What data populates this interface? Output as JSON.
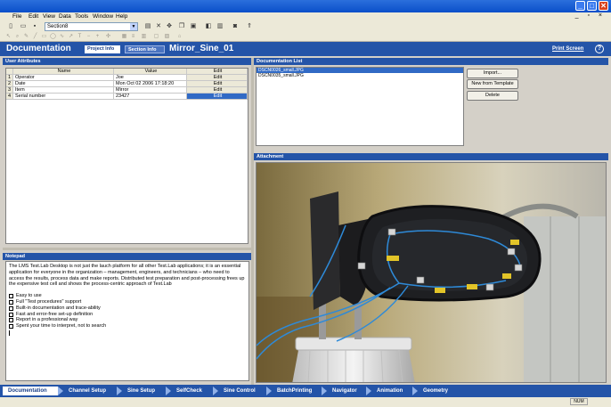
{
  "window": {
    "minimize_glyph": "_",
    "restore_glyph": "□",
    "close_glyph": "✕"
  },
  "menu": {
    "items": [
      "File",
      "Edit",
      "View",
      "Data",
      "Tools",
      "Window",
      "Help"
    ],
    "window_controls": "_ ▫ ×"
  },
  "toolbar": {
    "section_select": "Section8",
    "icons": [
      "new-icon",
      "open-icon",
      "save-icon",
      "print-icon",
      "cut-icon",
      "move-icon",
      "copy-icon",
      "paste-icon",
      "preview-icon",
      "printer-icon",
      "camera-icon",
      "pin-icon"
    ]
  },
  "header": {
    "title": "Documentation",
    "tab_active": "Project Info",
    "tab_inactive": "Section Info",
    "section_name": "Mirror_Sine_01",
    "print_screen": "Print Screen",
    "help": "?"
  },
  "user_attributes": {
    "title": "User Attributes",
    "columns": [
      "Name",
      "Value",
      "Edit"
    ],
    "rows": [
      {
        "n": "1",
        "name": "Operator",
        "value": "Joe",
        "edit": "Edit"
      },
      {
        "n": "2",
        "name": "Date",
        "value": "Mon Oct 02 2006 17:18:20",
        "edit": "Edit"
      },
      {
        "n": "3",
        "name": "Item",
        "value": "Mirror",
        "edit": "Edit"
      },
      {
        "n": "4",
        "name": "Serial number",
        "value": "23427",
        "edit": "Edit"
      }
    ]
  },
  "notepad": {
    "title": "Notepad",
    "paragraph": "The LMS Test.Lab Desktop is not just the lauch platform for all other Test.Lab applications; it is an essential application for everyone in the organization – management, engineers, and technicians – who need to access the results, process data and make reports. Distributed test preparation and post-processing frees up the expensive test cell and shows the process-centric approach of Test.Lab",
    "items": [
      "Easy to use",
      "Full \"Test procedures\" support",
      "Built-in documentation and trace-ability",
      "Fast and error-free set-up definition",
      "Report in a professional way",
      "Spent your time to interpret, not to search"
    ]
  },
  "documentation_list": {
    "title": "Documentation List",
    "files": [
      "DSCN0026_small.JPG",
      "DSCN0035_small.JPG"
    ],
    "buttons": {
      "import": "Import...",
      "new_template": "New from Template",
      "delete": "Delete"
    }
  },
  "attachment": {
    "title": "Attachment"
  },
  "bottom_tabs": [
    "Documentation",
    "Channel Setup",
    "Sine Setup",
    "SelfCheck",
    "Sine Control",
    "BatchPrinting",
    "Navigator",
    "Animation",
    "Geometry"
  ],
  "status": {
    "num": "NUM"
  },
  "colors": {
    "accent": "#2454a8",
    "selection": "#316ac5"
  }
}
